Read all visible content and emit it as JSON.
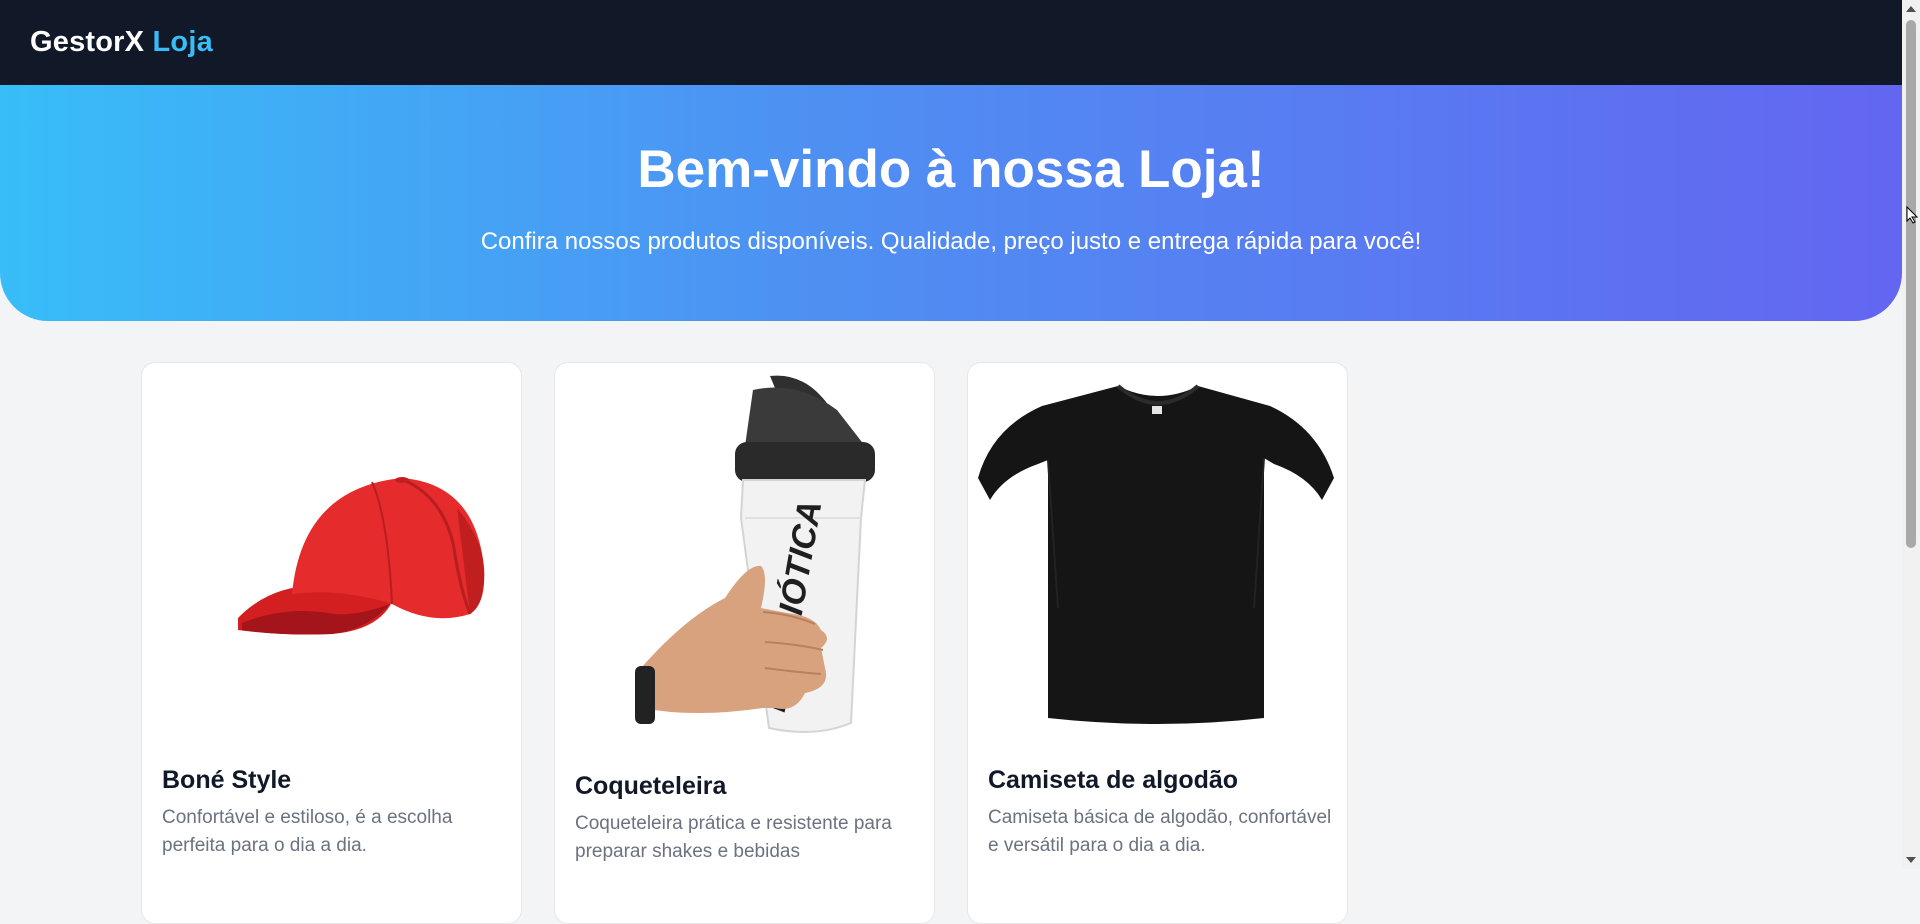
{
  "header": {
    "brand_main": "GestorX",
    "brand_accent": "Loja"
  },
  "hero": {
    "title": "Bem-vindo à nossa Loja!",
    "subtitle": "Confira nossos produtos disponíveis. Qualidade, preço justo e entrega rápida para você!"
  },
  "products": [
    {
      "name": "Boné Style",
      "description": "Confortável e estiloso, é a escolha perfeita para o dia a dia.",
      "image": "red-cap-image"
    },
    {
      "name": "Coqueteleira",
      "description": "Coqueteleira prática e resistente para preparar shakes e bebidas",
      "image": "shaker-bottle-image",
      "image_text": "PROBIÓTICA"
    },
    {
      "name": "Camiseta de algodão",
      "description": "Camiseta básica de algodão, confortável e versátil para o dia a dia.",
      "image": "black-tshirt-image"
    }
  ],
  "colors": {
    "topbar": "#111827",
    "brand_accent": "#38bdf8",
    "hero_gradient_start": "#38bdf8",
    "hero_gradient_end": "#6366f1",
    "page_background": "#f3f4f6"
  }
}
